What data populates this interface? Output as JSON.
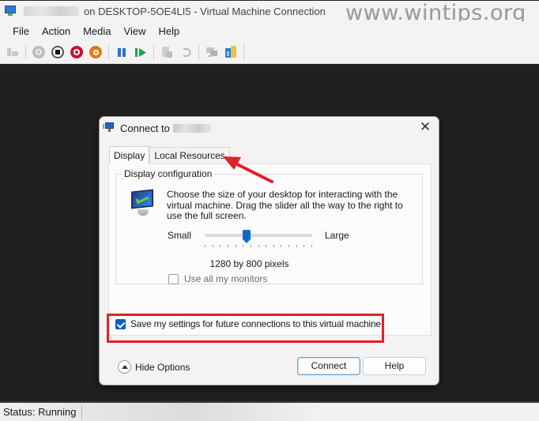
{
  "window": {
    "title_host": "on DESKTOP-5OE4LI5 - Virtual Machine Connection",
    "watermark": "www.wintips.org"
  },
  "menu": [
    "File",
    "Action",
    "Media",
    "View",
    "Help"
  ],
  "toolbar": {
    "buttons": [
      "ctrl-alt-del-icon",
      "start-icon",
      "turn-off-icon",
      "shutdown-icon",
      "save-icon",
      "pause-icon",
      "resume-icon",
      "checkpoint-icon",
      "revert-icon",
      "enhanced-session-icon",
      "share-icon"
    ]
  },
  "status": {
    "text": "Status: Running"
  },
  "dialog": {
    "title": "Connect to",
    "close_glyph": "✕",
    "tabs": [
      {
        "label": "Display",
        "active": true
      },
      {
        "label": "Local Resources",
        "active": false
      }
    ],
    "group_label": "Display configuration",
    "description": "Choose the size of your desktop for interacting with the virtual machine. Drag the slider all the way to the right to use the full screen.",
    "slider": {
      "min_label": "Small",
      "max_label": "Large",
      "value_fraction": 0.39,
      "tick_count": 15
    },
    "resolution": "1280 by 800 pixels",
    "use_all_monitors": {
      "label": "Use all my monitors",
      "checked": false,
      "enabled": false
    },
    "save_settings": {
      "label": "Save my settings for future connections to this virtual machine.",
      "checked": true
    },
    "hide_options_label": "Hide Options",
    "connect_label": "Connect",
    "help_label": "Help"
  },
  "annotations": {
    "highlight_color": "#e0202a",
    "arrow_color": "#e0202a"
  }
}
